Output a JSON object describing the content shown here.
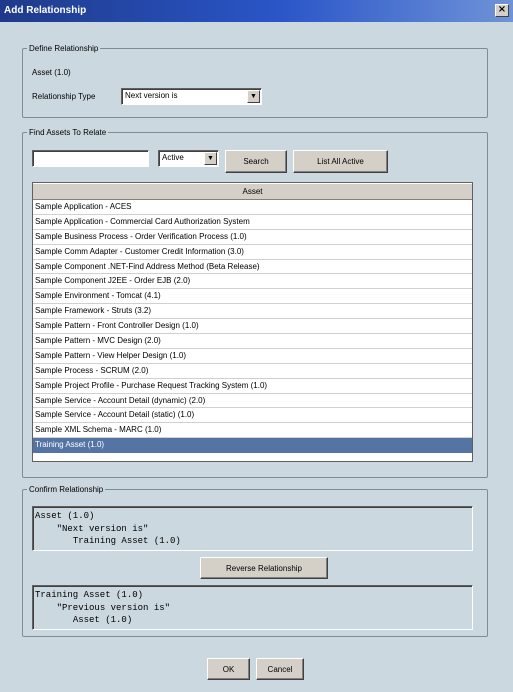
{
  "window": {
    "title": "Add Relationship",
    "close_glyph": "×"
  },
  "define": {
    "legend": "Define Relationship",
    "asset_label": "Asset (1.0)",
    "rel_type_label": "Relationship Type",
    "rel_type_value": "Next version is"
  },
  "find": {
    "legend": "Find Assets To Relate",
    "search_value": "",
    "status_value": "Active",
    "search_button": "Search",
    "list_all_button": "List All Active",
    "column_header": "Asset",
    "items": [
      "Sample Application - ACES",
      "Sample Application - Commercial Card Authorization System",
      "Sample Business Process - Order Verification Process (1.0)",
      "Sample Comm Adapter - Customer Credit Information (3.0)",
      "Sample Component .NET-Find Address Method (Beta Release)",
      "Sample Component J2EE - Order EJB (2.0)",
      "Sample Environment - Tomcat (4.1)",
      "Sample Framework - Struts (3.2)",
      "Sample Pattern - Front Controller Design (1.0)",
      "Sample Pattern - MVC Design (2.0)",
      "Sample Pattern - View Helper Design (1.0)",
      "Sample Process - SCRUM (2.0)",
      "Sample Project Profile - Purchase Request Tracking System (1.0)",
      "Sample Service - Account Detail (dynamic) (2.0)",
      "Sample Service - Account Detail (static) (1.0)",
      "Sample XML Schema - MARC (1.0)",
      "Training Asset (1.0)"
    ],
    "selected_index": 16
  },
  "confirm": {
    "legend": "Confirm Relationship",
    "forward": {
      "line1": "Asset (1.0)",
      "line2": "\"Next version is\"",
      "line3": "Training Asset (1.0)"
    },
    "reverse_button": "Reverse Relationship",
    "backward": {
      "line1": "Training Asset (1.0)",
      "line2": "\"Previous version is\"",
      "line3": "Asset (1.0)"
    }
  },
  "footer": {
    "ok_label": "OK",
    "cancel_label": "Cancel"
  }
}
